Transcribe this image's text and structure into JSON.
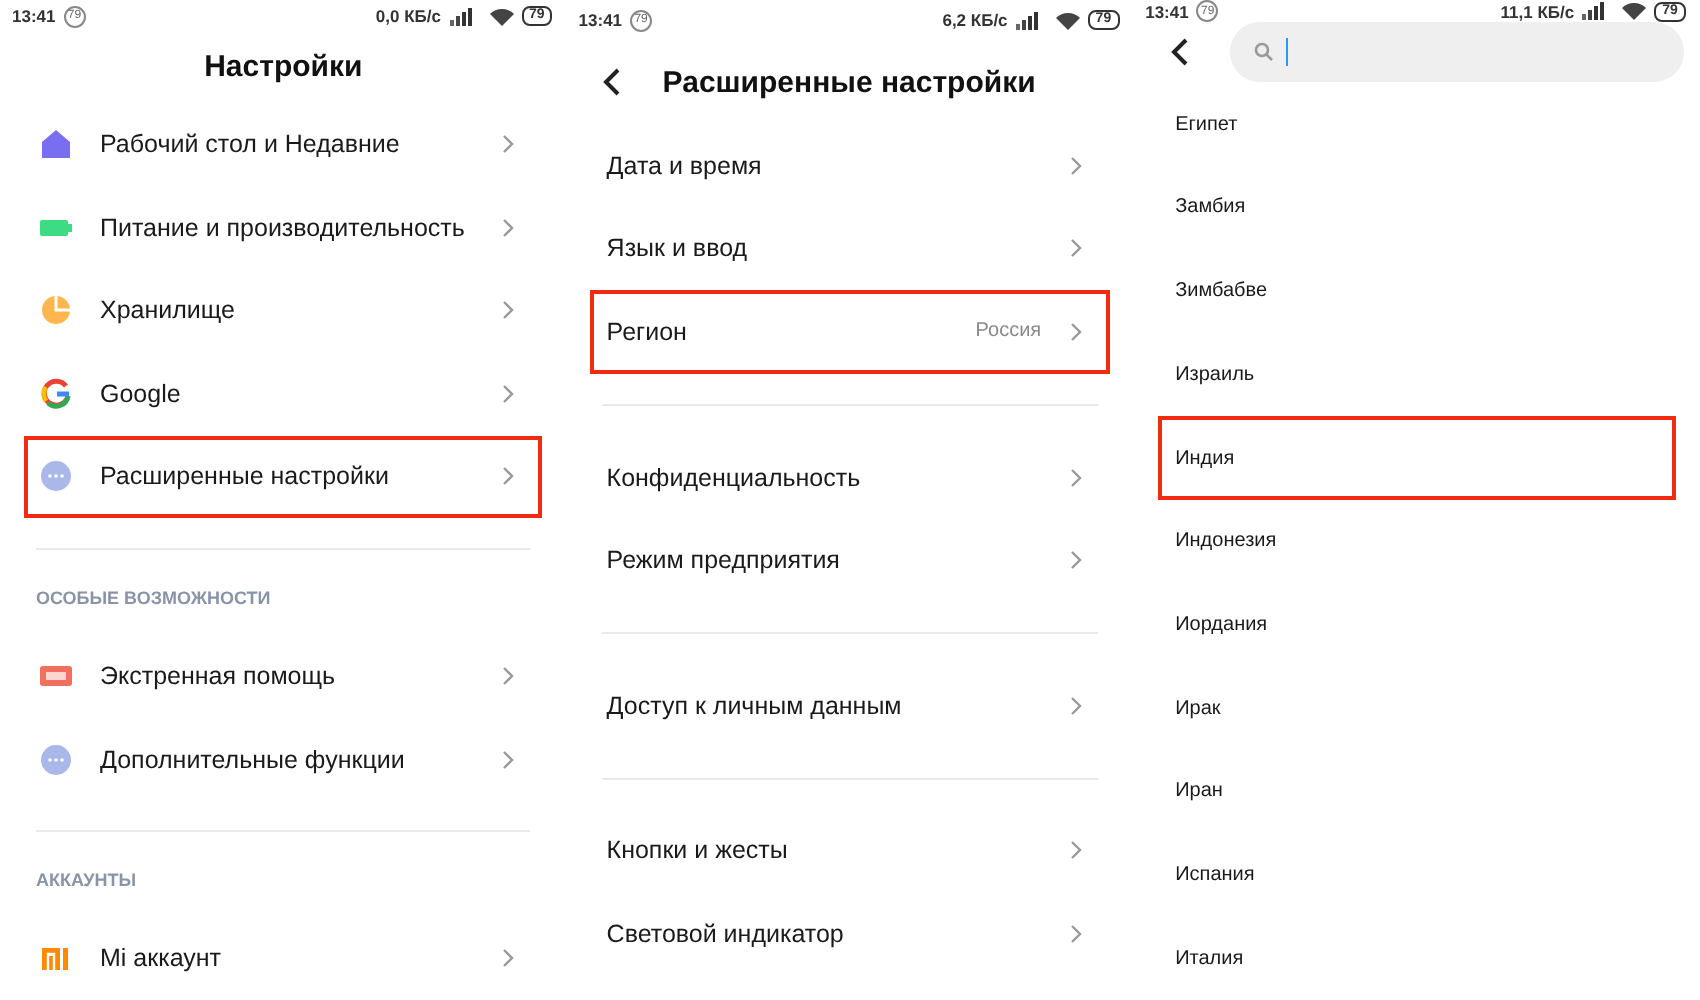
{
  "screens": [
    {
      "kind": "settings",
      "status_bar": {
        "time": "13:41",
        "notification_count": "79",
        "speed": "0,0 КБ/с",
        "battery": "79"
      },
      "back": false,
      "title": "Настройки",
      "groups": [
        {
          "items": [
            {
              "label": "Рабочий стол и Недавние",
              "highlighted": false
            },
            {
              "label": "Питание и производительность",
              "highlighted": false
            },
            {
              "label": "Хранилище",
              "highlighted": false
            },
            {
              "label": "Google",
              "highlighted": false
            },
            {
              "label": "Расширенные настройки",
              "highlighted": true
            }
          ]
        },
        {
          "heading": "ОСОБЫЕ ВОЗМОЖНОСТИ",
          "items": [
            {
              "label": "Экстренная помощь",
              "highlighted": false
            },
            {
              "label": "Дополнительные функции",
              "highlighted": false
            }
          ]
        },
        {
          "heading": "АККАУНТЫ",
          "items": [
            {
              "label": "Mi аккаунт",
              "highlighted": false
            }
          ]
        }
      ]
    },
    {
      "kind": "submenu",
      "status_bar": {
        "time": "13:41",
        "notification_count": "79",
        "speed": "6,2 КБ/с",
        "battery": "79"
      },
      "back": true,
      "title": "Расширенные настройки",
      "groups": [
        {
          "items": [
            {
              "label": "Дата и время",
              "highlighted": false
            },
            {
              "label": "Язык и ввод",
              "highlighted": false
            },
            {
              "label": "Регион",
              "value": "Россия",
              "highlighted": true
            }
          ]
        },
        {
          "items": [
            {
              "label": "Конфиденциальность",
              "highlighted": false
            },
            {
              "label": "Режим предприятия",
              "highlighted": false
            }
          ]
        },
        {
          "items": [
            {
              "label": "Доступ к личным данным",
              "highlighted": false
            }
          ]
        },
        {
          "items": [
            {
              "label": "Кнопки и жесты",
              "highlighted": false
            },
            {
              "label": "Световой индикатор",
              "highlighted": false
            }
          ]
        }
      ]
    },
    {
      "kind": "picker",
      "status_bar": {
        "time": "13:41",
        "notification_count": "79",
        "speed": "11,1 КБ/с",
        "battery": "79"
      },
      "back": true,
      "search": {
        "focused": true
      },
      "groups": [
        {
          "items": [
            {
              "label": "Египет",
              "highlighted": false
            },
            {
              "label": "Замбия",
              "highlighted": false
            },
            {
              "label": "Зимбабве",
              "highlighted": false
            },
            {
              "label": "Израиль",
              "highlighted": false
            },
            {
              "label": "Индия",
              "highlighted": true
            },
            {
              "label": "Индонезия",
              "highlighted": false
            },
            {
              "label": "Иордания",
              "highlighted": false
            },
            {
              "label": "Ирак",
              "highlighted": false
            },
            {
              "label": "Иран",
              "highlighted": false
            },
            {
              "label": "Испания",
              "highlighted": false
            },
            {
              "label": "Италия",
              "highlighted": false
            }
          ]
        }
      ]
    }
  ]
}
